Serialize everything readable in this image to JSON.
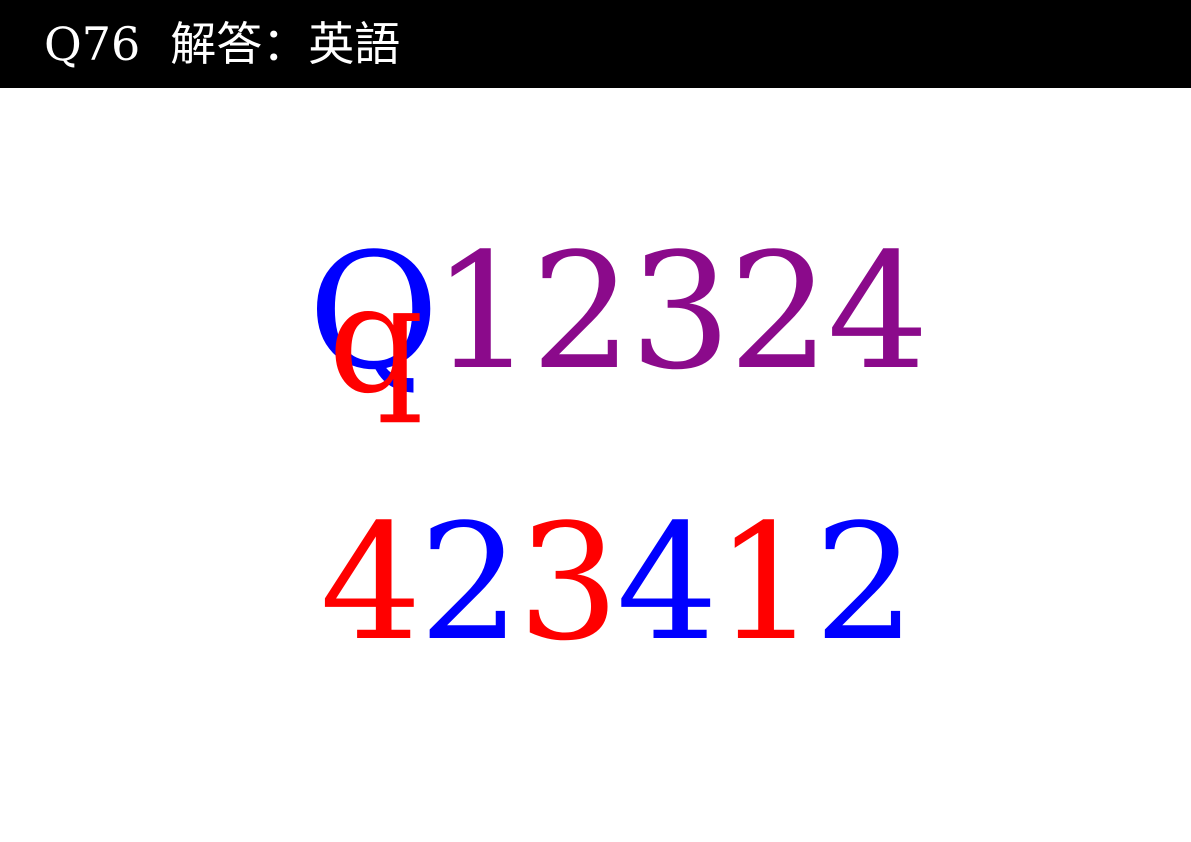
{
  "header": {
    "question_number": "Q76",
    "subject": "解答：英語"
  },
  "answer_line_1": {
    "overlay_big": "Q",
    "overlay_small": "q",
    "digits": "12324"
  },
  "answer_line_2": {
    "digits": [
      "4",
      "2",
      "3",
      "4",
      "1",
      "2"
    ]
  },
  "colors": {
    "header_background": "#000000",
    "header_text": "#ffffff",
    "blue": "#0000ff",
    "red": "#ff0000",
    "purple": "#8b0a8b"
  }
}
